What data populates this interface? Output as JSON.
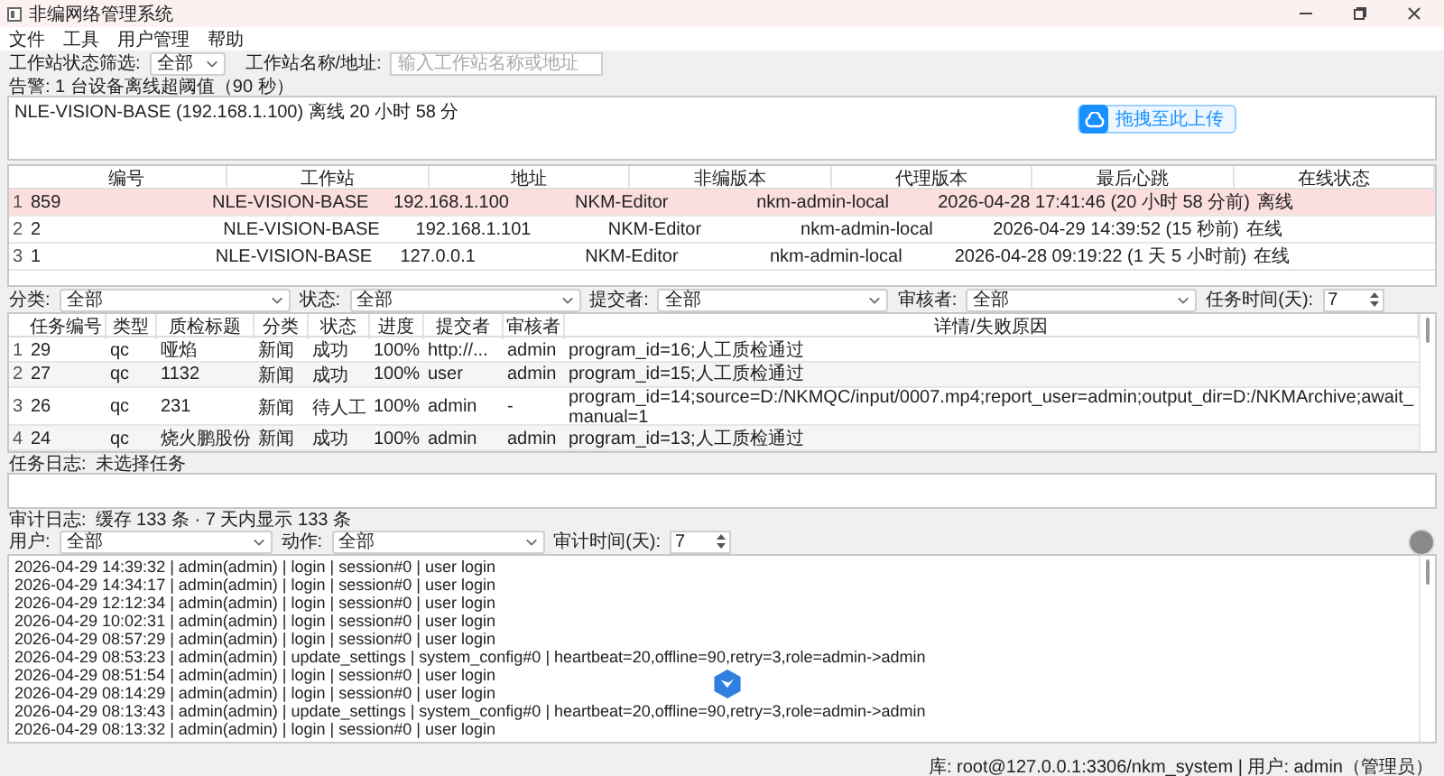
{
  "window": {
    "title": "非编网络管理系统"
  },
  "menu": [
    "文件",
    "工具",
    "用户管理",
    "帮助"
  ],
  "station_filter": {
    "status_label": "工作站状态筛选:",
    "status_value": "全部",
    "name_label": "工作站名称/地址:",
    "name_placeholder": "输入工作站名称或地址"
  },
  "alert": {
    "label": "告警: 1 台设备离线超阈值（90 秒）",
    "text": "NLE-VISION-BASE (192.168.1.100) 离线 20 小时 58 分",
    "upload_button": "拖拽至此上传"
  },
  "stations": {
    "columns": [
      "编号",
      "工作站",
      "地址",
      "非编版本",
      "代理版本",
      "最后心跳",
      "在线状态"
    ],
    "rows": [
      {
        "row_number": "1",
        "offline": true,
        "cells": [
          "859",
          "NLE-VISION-BASE",
          "192.168.1.100",
          "NKM-Editor",
          "nkm-admin-local",
          "2026-04-28 17:41:46 (20 小时 58 分前)",
          "离线"
        ]
      },
      {
        "row_number": "2",
        "offline": false,
        "cells": [
          "2",
          "NLE-VISION-BASE",
          "192.168.1.101",
          "NKM-Editor",
          "nkm-admin-local",
          "2026-04-29 14:39:52 (15 秒前)",
          "在线"
        ]
      },
      {
        "row_number": "3",
        "offline": false,
        "cells": [
          "1",
          "NLE-VISION-BASE",
          "127.0.0.1",
          "NKM-Editor",
          "nkm-admin-local",
          "2026-04-28 09:19:22 (1 天 5 小时前)",
          "在线"
        ]
      }
    ]
  },
  "task_filters": [
    {
      "kind": "combo",
      "label": "分类:",
      "value": "全部"
    },
    {
      "kind": "combo",
      "label": "状态:",
      "value": "全部"
    },
    {
      "kind": "combo",
      "label": "提交者:",
      "value": "全部"
    },
    {
      "kind": "combo",
      "label": "审核者:",
      "value": "全部"
    },
    {
      "kind": "spin",
      "label": "任务时间(天):",
      "value": "7"
    }
  ],
  "tasks": {
    "columns": [
      "任务编号",
      "类型",
      "质检标题",
      "分类",
      "状态",
      "进度",
      "提交者",
      "审核者",
      "详情/失败原因"
    ],
    "rows": [
      {
        "row_number": "1",
        "cells": [
          "29",
          "qc",
          "哑焰",
          "新闻",
          "成功",
          "100%",
          "http://...",
          "admin",
          "program_id=16;人工质检通过"
        ]
      },
      {
        "row_number": "2",
        "cells": [
          "27",
          "qc",
          "1132",
          "新闻",
          "成功",
          "100%",
          "user",
          "admin",
          "program_id=15;人工质检通过"
        ]
      },
      {
        "row_number": "3",
        "cells": [
          "26",
          "qc",
          "231",
          "新闻",
          "待人工",
          "100%",
          "admin",
          "-",
          "program_id=14;source=D:/NKMQC/input/0007.mp4;report_user=admin;output_dir=D:/NKMArchive;await_manual=1"
        ]
      },
      {
        "row_number": "4",
        "cells": [
          "24",
          "qc",
          "烧火鹏股份",
          "新闻",
          "成功",
          "100%",
          "admin",
          "admin",
          "program_id=13;人工质检通过"
        ]
      }
    ]
  },
  "task_log": {
    "label": "任务日志:",
    "value": "未选择任务"
  },
  "audit": {
    "label": "审计日志:",
    "summary": "缓存 133 条 · 7 天内显示 133 条",
    "filters": [
      {
        "kind": "combo",
        "label": "用户:",
        "value": "全部"
      },
      {
        "kind": "combo",
        "label": "动作:",
        "value": "全部"
      },
      {
        "kind": "spin",
        "label": "审计时间(天):",
        "value": "7"
      }
    ],
    "lines": [
      "2026-04-29 14:39:32 | admin(admin) | login | session#0 | user login",
      "2026-04-29 14:34:17 | admin(admin) | login | session#0 | user login",
      "2026-04-29 12:12:34 | admin(admin) | login | session#0 | user login",
      "2026-04-29 10:02:31 | admin(admin) | login | session#0 | user login",
      "2026-04-29 08:57:29 | admin(admin) | login | session#0 | user login",
      "2026-04-29 08:53:23 | admin(admin) | update_settings | system_config#0 | heartbeat=20,offline=90,retry=3,role=admin->admin",
      "2026-04-29 08:51:54 | admin(admin) | login | session#0 | user login",
      "2026-04-29 08:14:29 | admin(admin) | login | session#0 | user login",
      "2026-04-29 08:13:43 | admin(admin) | update_settings | system_config#0 | heartbeat=20,offline=90,retry=3,role=admin->admin",
      "2026-04-29 08:13:32 | admin(admin) | login | session#0 | user login"
    ]
  },
  "status_bar": "库: root@127.0.0.1:3306/nkm_system | 用户: admin（管理员）"
}
